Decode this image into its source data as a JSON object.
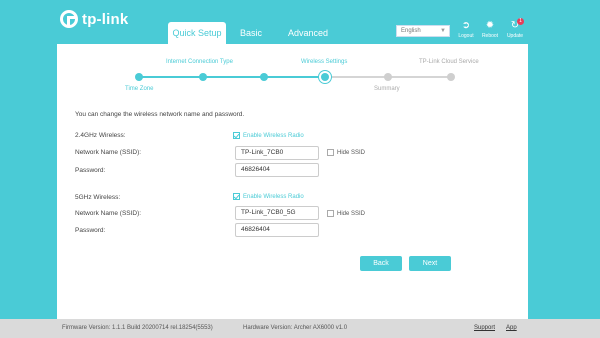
{
  "brand": {
    "name": "tp-link"
  },
  "tabs": [
    {
      "label": "Quick Setup",
      "active": true
    },
    {
      "label": "Basic",
      "active": false
    },
    {
      "label": "Advanced",
      "active": false
    }
  ],
  "language": {
    "selected": "English"
  },
  "top_actions": {
    "logout": "Logout",
    "reboot": "Reboot",
    "update": "Update",
    "update_badge": "1"
  },
  "steps": [
    {
      "label": "Time Zone",
      "state": "done"
    },
    {
      "label": "Internet Connection Type",
      "state": "done"
    },
    {
      "label": "Wireless Settings",
      "state": "current"
    },
    {
      "label": "Summary",
      "state": "todo"
    },
    {
      "label": "TP-Link Cloud Service",
      "state": "todo"
    }
  ],
  "form": {
    "intro": "You can change the wireless network name and password.",
    "band24": {
      "section_label": "2.4GHz Wireless:",
      "enable_label": "Enable Wireless Radio",
      "ssid_label": "Network Name (SSID):",
      "ssid_value": "TP-Link_7CB0",
      "hide_label": "Hide SSID",
      "password_label": "Password:",
      "password_value": "46826404"
    },
    "band5": {
      "section_label": "5GHz Wireless:",
      "enable_label": "Enable Wireless Radio",
      "ssid_label": "Network Name (SSID):",
      "ssid_value": "TP-Link_7CB0_5G",
      "hide_label": "Hide SSID",
      "password_label": "Password:",
      "password_value": "46826404"
    }
  },
  "buttons": {
    "back": "Back",
    "next": "Next"
  },
  "footer": {
    "firmware": "Firmware Version: 1.1.1 Build 20200714 rel.18254(5553)",
    "hardware": "Hardware Version: Archer AX6000 v1.0",
    "support": "Support",
    "app": "App"
  },
  "colors": {
    "accent": "#4acbd6",
    "footer_bg": "#dadada"
  }
}
